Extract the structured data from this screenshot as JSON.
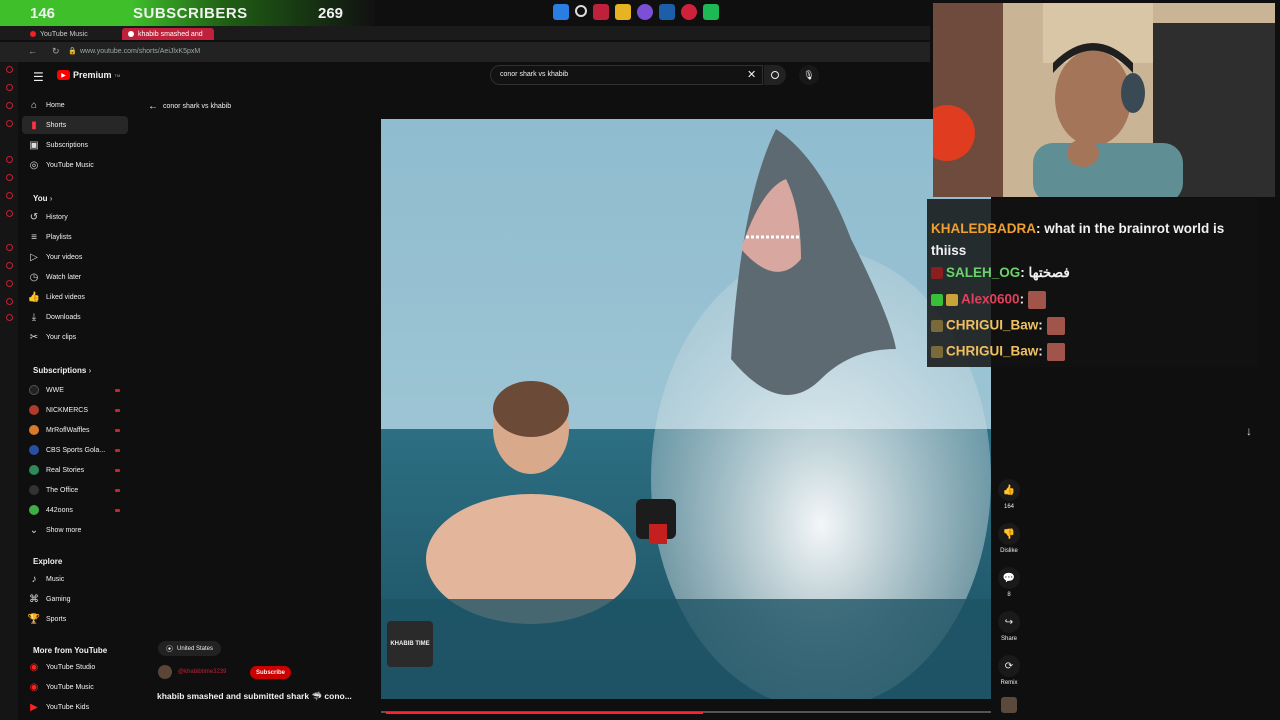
{
  "overlay": {
    "sub_count": "146",
    "sub_label": "SUBSCRIBERS",
    "sub_goal": "269"
  },
  "browser": {
    "tabs": [
      {
        "label": "YouTube Music"
      },
      {
        "label": "khabib smashed and"
      }
    ],
    "url": "www.youtube.com/shorts/AeiJlxK5pxM"
  },
  "brand": {
    "name": "Premium",
    "tm": "TM"
  },
  "search": {
    "value": "conor shark vs khabib"
  },
  "back": {
    "label": "conor shark vs khabib"
  },
  "sidebar": {
    "main": [
      {
        "label": "Home",
        "icon": "home-icon"
      },
      {
        "label": "Shorts",
        "icon": "shorts-icon",
        "active": true
      },
      {
        "label": "Subscriptions",
        "icon": "subscriptions-icon"
      },
      {
        "label": "YouTube Music",
        "icon": "music-icon"
      }
    ],
    "you_heading": "You",
    "you": [
      {
        "label": "History"
      },
      {
        "label": "Playlists"
      },
      {
        "label": "Your videos"
      },
      {
        "label": "Watch later"
      },
      {
        "label": "Liked videos"
      },
      {
        "label": "Downloads"
      },
      {
        "label": "Your clips"
      }
    ],
    "subs_heading": "Subscriptions",
    "subscriptions": [
      {
        "label": "WWE",
        "color": "#222222"
      },
      {
        "label": "NICKMERCS",
        "color": "#b23a2a"
      },
      {
        "label": "MrRoflWaffles",
        "color": "#d97a2b"
      },
      {
        "label": "CBS Sports Gola...",
        "color": "#2a4fa0"
      },
      {
        "label": "Real Stories",
        "color": "#2f8a5a"
      },
      {
        "label": "The Office",
        "color": "#333333"
      },
      {
        "label": "442oons",
        "color": "#3fae49"
      }
    ],
    "show_more": "Show more",
    "explore_heading": "Explore",
    "explore": [
      {
        "label": "Music"
      },
      {
        "label": "Gaming"
      },
      {
        "label": "Sports"
      }
    ],
    "more_heading": "More from YouTube",
    "more": [
      {
        "label": "YouTube Studio"
      },
      {
        "label": "YouTube Music"
      },
      {
        "label": "YouTube Kids"
      }
    ]
  },
  "short": {
    "location": "United States",
    "channel": "@khabibtime3239",
    "subscribe": "Subscribe",
    "title": "khabib smashed and submitted shark 🦈 cono...",
    "watermark": "KHABIB TIME",
    "progress": 0.52
  },
  "actions": {
    "likes": "164",
    "dislike": "Dislike",
    "comments": "8",
    "share": "Share",
    "remix": "Remix"
  },
  "chat": [
    {
      "user": "KHALEDBADRA",
      "text": ": what in the brainrot world is thiiss",
      "color": "#f0a030"
    },
    {
      "user": "SALEH_OG",
      "text": ": فصختها",
      "color": "#6bd36b"
    },
    {
      "user": "Alex0600",
      "text": ":",
      "color": "#e0405a"
    },
    {
      "user": "CHRIGUI_Baw",
      "text": ":",
      "color": "#f0c060"
    },
    {
      "user": "CHRIGUI_Baw",
      "text": ":",
      "color": "#f0c060"
    }
  ]
}
